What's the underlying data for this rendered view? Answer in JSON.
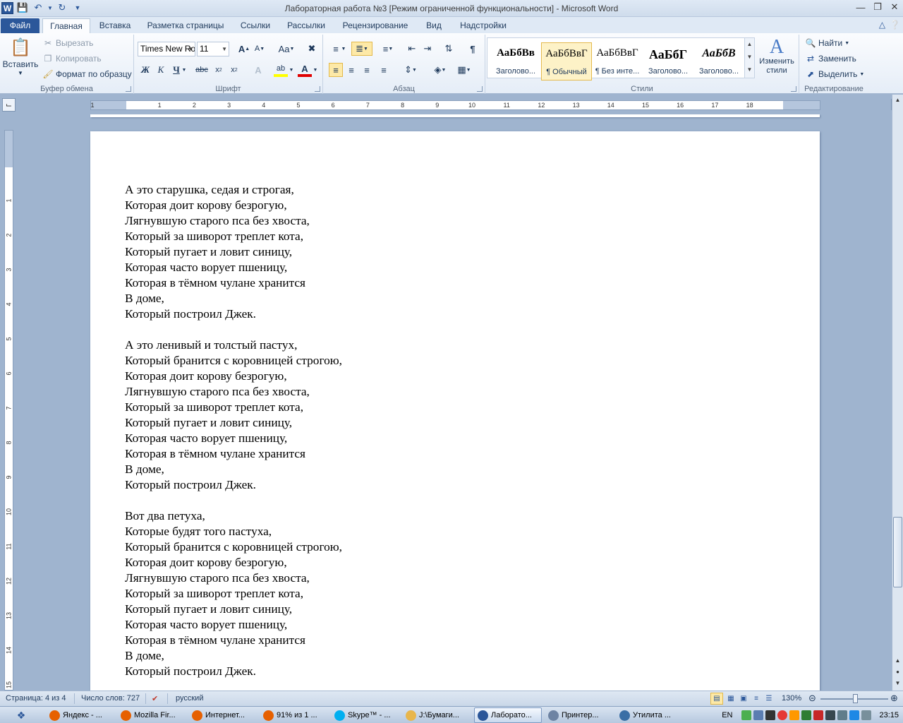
{
  "window": {
    "title": "Лабораторная работа №3 [Режим ограниченной функциональности]  -  Microsoft Word",
    "app_icon": "word-icon",
    "qat": [
      "save-icon",
      "undo-icon",
      "redo-icon",
      "customize-icon"
    ],
    "controls": [
      "minimize-icon",
      "maximize-icon",
      "close-icon"
    ]
  },
  "tabs": [
    {
      "label": "Файл",
      "kind": "file"
    },
    {
      "label": "Главная",
      "kind": "active"
    },
    {
      "label": "Вставка"
    },
    {
      "label": "Разметка страницы"
    },
    {
      "label": "Ссылки"
    },
    {
      "label": "Рассылки"
    },
    {
      "label": "Рецензирование"
    },
    {
      "label": "Вид"
    },
    {
      "label": "Надстройки"
    }
  ],
  "ribbon": {
    "clipboard": {
      "paste": "Вставить",
      "cut": "Вырезать",
      "copy": "Копировать",
      "format_painter": "Формат по образцу",
      "label": "Буфер обмена"
    },
    "font": {
      "font_name": "Times New Ro",
      "font_size": "11",
      "label": "Шрифт"
    },
    "paragraph": {
      "label": "Абзац"
    },
    "styles": {
      "label": "Стили",
      "items": [
        {
          "sample": "АаБбВв",
          "name": "Заголово..."
        },
        {
          "sample": "АаБбВвГ",
          "name": "¶ Обычный",
          "selected": true
        },
        {
          "sample": "АаБбВвГ",
          "name": "¶ Без инте..."
        },
        {
          "sample": "АаБбГ",
          "name": "Заголово..."
        },
        {
          "sample": "АаБбВ",
          "name": "Заголово..."
        }
      ],
      "change_styles": "Изменить стили"
    },
    "editing": {
      "label": "Редактирование",
      "find": "Найти",
      "replace": "Заменить",
      "select": "Выделить"
    }
  },
  "ruler": {
    "numbers": [
      "1",
      "1",
      "2",
      "3",
      "4",
      "5",
      "6",
      "7",
      "8",
      "9",
      "10",
      "11",
      "12",
      "13",
      "14",
      "15",
      "16",
      "17",
      "18"
    ],
    "vertical_numbers": [
      "1",
      "2",
      "3",
      "4",
      "5",
      "6",
      "7",
      "8",
      "9",
      "10",
      "11",
      "12",
      "13",
      "14",
      "15"
    ]
  },
  "document": {
    "stanzas": [
      [
        "А это старушка, седая и строгая,",
        "Которая доит корову безрогую,",
        "Лягнувшую старого пса без хвоста,",
        "Который за шиворот треплет кота,",
        "Который пугает и ловит синицу,",
        "Которая часто ворует пшеницу,",
        "Которая в тёмном чулане хранится",
        "В доме,",
        "Который построил Джек."
      ],
      [
        "А это ленивый и толстый пастух,",
        "Который бранится с коровницей строгою,",
        "Которая доит корову безрогую,",
        "Лягнувшую старого пса без хвоста,",
        "Который за шиворот треплет кота,",
        "Который пугает и ловит синицу,",
        "Которая часто ворует пшеницу,",
        "Которая в тёмном чулане хранится",
        "В доме,",
        "Который построил Джек."
      ],
      [
        "Вот два петуха,",
        "Которые будят того пастуха,",
        "Который бранится с коровницей строгою,",
        "Которая доит корову безрогую,",
        "Лягнувшую старого пса без хвоста,",
        "Который за шиворот треплет кота,",
        "Который пугает и ловит синицу,",
        "Которая часто ворует пшеницу,",
        "Которая в тёмном чулане хранится",
        "В доме,",
        "Который построил Джек."
      ]
    ]
  },
  "status": {
    "page": "Страница: 4 из 4",
    "words": "Число слов: 727",
    "language": "русский",
    "zoom": "130%"
  },
  "taskbar": {
    "items": [
      {
        "label": "Яндекс - ...",
        "icon": "firefox-icon",
        "color": "#e66000"
      },
      {
        "label": "Mozilla Fir...",
        "icon": "firefox-icon",
        "color": "#e66000"
      },
      {
        "label": "Интернет...",
        "icon": "firefox-icon",
        "color": "#e66000"
      },
      {
        "label": "91% из 1 ...",
        "icon": "firefox-icon",
        "color": "#e66000"
      },
      {
        "label": "Skype™ - ...",
        "icon": "skype-icon",
        "color": "#00aff0"
      },
      {
        "label": "J:\\Бумаги...",
        "icon": "folder-icon",
        "color": "#e8b64c"
      },
      {
        "label": "Лаборато...",
        "icon": "word-icon",
        "color": "#2a5699",
        "active": true
      },
      {
        "label": "Принтер...",
        "icon": "printer-icon",
        "color": "#6d83a3"
      },
      {
        "label": "Утилита ...",
        "icon": "utility-icon",
        "color": "#3a6ea5"
      }
    ],
    "lang": "EN",
    "clock": "23:15"
  }
}
